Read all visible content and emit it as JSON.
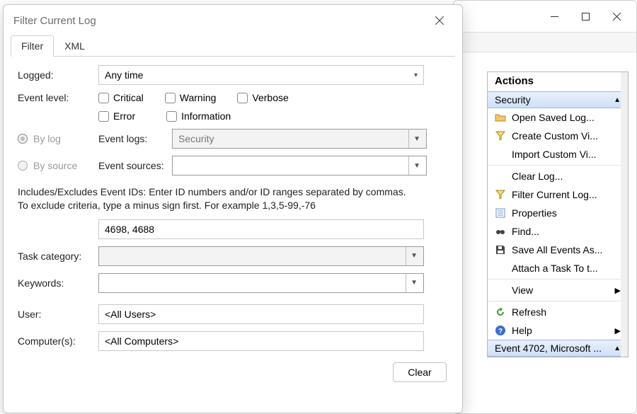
{
  "dialog": {
    "title": "Filter Current Log",
    "tabs": {
      "filter": "Filter",
      "xml": "XML"
    },
    "labels": {
      "logged": "Logged:",
      "event_level": "Event level:",
      "by_log": "By log",
      "by_source": "By source",
      "event_logs": "Event logs:",
      "event_sources": "Event sources:",
      "task_category": "Task category:",
      "keywords": "Keywords:",
      "user": "User:",
      "computers": "Computer(s):"
    },
    "logged_value": "Any time",
    "levels": {
      "critical": "Critical",
      "warning": "Warning",
      "verbose": "Verbose",
      "error": "Error",
      "information": "Information"
    },
    "event_logs_value": "Security",
    "event_sources_value": "",
    "include_desc": "Includes/Excludes Event IDs: Enter ID numbers and/or ID ranges separated by commas. To exclude criteria, type a minus sign first. For example 1,3,5-99,-76",
    "event_ids_value": "4698, 4688",
    "task_category_value": "",
    "keywords_value": "",
    "user_value": "<All Users>",
    "computers_value": "<All Computers>",
    "clear_btn": "Clear"
  },
  "actions": {
    "title": "Actions",
    "group1": "Security",
    "items": [
      "Open Saved Log...",
      "Create Custom Vi...",
      "Import Custom Vi...",
      "Clear Log...",
      "Filter Current Log...",
      "Properties",
      "Find...",
      "Save All Events As...",
      "Attach a Task To t...",
      "View",
      "Refresh",
      "Help"
    ],
    "group2": "Event 4702, Microsoft ..."
  }
}
